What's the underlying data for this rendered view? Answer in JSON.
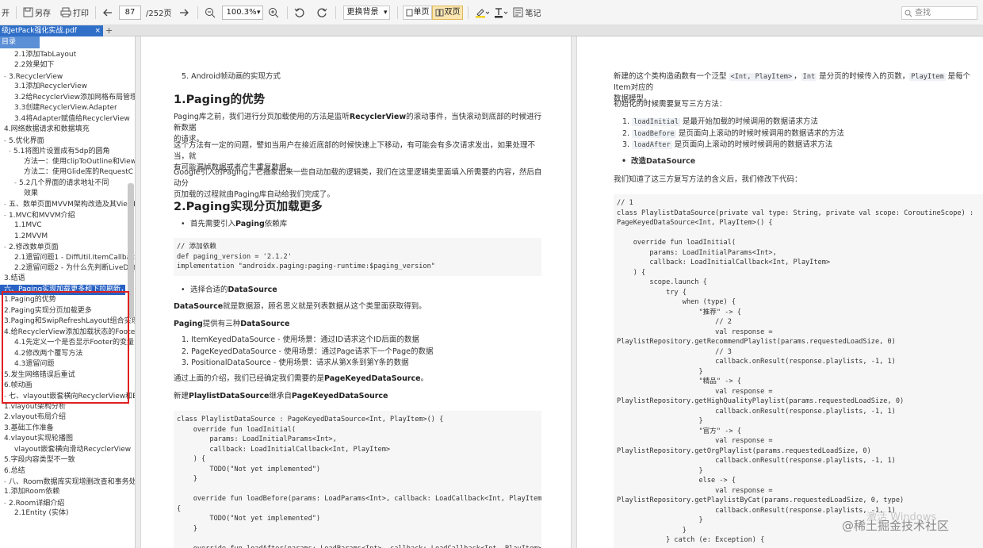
{
  "toolbar": {
    "open_label": "开",
    "saveas_label": "另存",
    "print_label": "打印",
    "page_current": "87",
    "page_total": "/252页",
    "zoom": "100.3%",
    "bg_label": "更换背景",
    "single_label": "单页",
    "double_label": "双页",
    "note_label": "笔记",
    "search_placeholder": "查找"
  },
  "tab": {
    "title": "级JetPack强化实战.pdf",
    "close": "×",
    "new": "+"
  },
  "sidebar": {
    "header": "目录",
    "items": [
      "2.1添加TabLayout",
      "2.2效果如下",
      "3.RecyclerView",
      "3.1添加RecyclerView",
      "3.2给RecyclerView添加网格布局管理",
      "3.3创建RecyclerView.Adapter",
      "3.4将Adapter赋值给RecyclerView",
      "4.网络数据请求和数据填充",
      "5.优化界面",
      "5.1将图片设置成有5dp的圆角",
      "方法一：使用clipToOutline和View",
      "方法二：使用Glide库的RequestC",
      "5.2几个界面的请求地址不同",
      "效果",
      "五、数单页面MVVM架构改造及其ViewM",
      "1.MVC和MVVM介绍",
      "1.1MVC",
      "1.2MVVM",
      "2.修改数单页面",
      "2.1遗留问题1 - DiffUtil.ItemCallback",
      "2.2遗留问题2 - 为什么先判断LiveDat",
      "3.结语",
      "六、Paging实现加载更多和下拉刷新，错",
      "1.Paging的优势",
      "2.Paging实现分页加载更多",
      "3.Paging和SwipRefreshLayout组合实现",
      "4.给RecyclerView添加加载状态的Footer",
      "4.1先定义一个是否显示Footer的变量",
      "4.2修改两个覆写方法",
      "4.3遗留问题",
      "5.发生网络错误后重试",
      "6.帧动画",
      "七、vlayout嵌套横向RecyclerView和Bar",
      "1.vlayout架构分析",
      "2.vlayout布局介绍",
      "3.基础工作准备",
      "4.vlayout实现轮播图",
      "vlayout嵌套横向滑动RecyclerView",
      "5.字段内容类型不一致",
      "6.总结",
      "八、Room数据库实现增删改查和事务处理",
      "1.添加Room依赖",
      "2.Room详细介绍",
      "2.1Entity (实体)"
    ]
  },
  "page1": {
    "item5": "5. Android帧动画的实现方式",
    "h1": "1.Paging的优势",
    "p1": [
      "Paging库之前，我们进行分页加载使用的方法是监听",
      "RecyclerView",
      "的滚动事件，当快滚动到底部的时候进行新数据",
      "的请求。"
    ],
    "p2": [
      "这个方法有一定的问题，譬如当用户在接近底部的时候快速上下移动，有可能会有多次请求发出，如果处理不当，就",
      "有可能漏掉数据或者产生重复数据。"
    ],
    "p3": [
      "Google引入的Paging，它抽象出来一些自动加载的逻辑类，我们在这里逻辑类里面填入所需要的内容，然后自动分",
      "页加载的过程就由Paging库自动给我们完成了。"
    ],
    "h2": "2.Paging实现分页加载更多",
    "bullet1": [
      "首先需要引入",
      "Paging",
      "依赖库"
    ],
    "code1": "// 添加依赖\ndef paging_version = '2.1.2'\nimplementation \"androidx.paging:paging-runtime:$paging_version\"",
    "bullet2": [
      "选择合适的",
      "DataSource"
    ],
    "ds_line": [
      "DataSource",
      "就是数据源，顾名思义就是列表数据从这个类里面获取得到。"
    ],
    "paging_line": [
      "Paging",
      "提供有三种",
      "DataSource"
    ],
    "list": [
      "ItemKeyedDataSource - 使用场景：通过ID请求这个ID后面的数据",
      "PageKeyedDataSource - 使用场景：通过Page请求下一个Page的数据",
      "PositionalDataSource - 使用场景：请求从第X条到第Y条的数据"
    ],
    "choose": [
      "通过上面的介绍，我们已经确定我们需要的是",
      "PageKeyedDataSource",
      "。"
    ],
    "newbuild": [
      "新建",
      "PlaylistDataSource",
      "继承自",
      "PageKeyedDataSource"
    ],
    "code2": "class PlaylistDataSource : PageKeyedDataSource<Int, PlayItem>() {\n    override fun loadInitial(\n        params: LoadInitialParams<Int>,\n        callback: LoadInitialCallback<Int, PlayItem>\n    ) {\n        TODO(\"Not yet implemented\")\n    }\n\n    override fun loadBefore(params: LoadParams<Int>, callback: LoadCallback<Int, PlayItem>)\n{\n        TODO(\"Not yet implemented\")\n    }\n\n    override fun loadAfter(params: LoadParams<Int>, callback: LoadCallback<Int, PlayItem>) {"
  },
  "page2": {
    "intro": [
      "新建的这个类构造函数有一个泛型 ",
      "<Int, PlayItem>",
      "，",
      "Int",
      " 是分页的时候传入的页数，",
      "PlayItem",
      " 是每个Item对应的",
      "数据模型。"
    ],
    "init_line": "初始化的时候需要复写三方方法：",
    "methods": [
      {
        "code": "loadInitial",
        "text": " 是最开始加载的时候调用的数据请求方法"
      },
      {
        "code": "loadBefore",
        "text": " 是页面向上滚动的时候时候调用的数据请求的方法"
      },
      {
        "code": "loadAfter",
        "text": " 是页面向上滚动的时候时候调用的数据请求方法"
      }
    ],
    "bullet": "改造DataSource",
    "know": "我们知道了这三方复写方法的含义后，我们修改下代码：",
    "code": "// 1\nclass PlaylistDataSource(private val type: String, private val scope: CoroutineScope) :\nPageKeyedDataSource<Int, PlayItem>() {\n\n    override fun loadInitial(\n        params: LoadInitialParams<Int>,\n        callback: LoadInitialCallback<Int, PlayItem>\n    ) {\n        scope.launch {\n            try {\n                when (type) {\n                    \"推荐\" -> {\n                        // 2\n                        val response =\nPlaylistRepository.getRecommendPlaylist(params.requestedLoadSize, 0)\n                        // 3\n                        callback.onResult(response.playlists, -1, 1)\n                    }\n                    \"精品\" -> {\n                        val response =\nPlaylistRepository.getHighQualityPlaylist(params.requestedLoadSize, 0)\n                        callback.onResult(response.playlists, -1, 1)\n                    }\n                    \"官方\" -> {\n                        val response =\nPlaylistRepository.getOrgPlaylist(params.requestedLoadSize, 0)\n                        callback.onResult(response.playlists, -1, 1)\n                    }\n                    else -> {\n                        val response =\nPlaylistRepository.getPlaylistByCat(params.requestedLoadSize, 0, type)\n                        callback.onResult(response.playlists, -1, 1)\n                    }\n                }\n            } catch (e: Exception) {"
  },
  "watermark": {
    "os": "激活 Windows",
    "site": "@稀土掘金技术社区"
  }
}
